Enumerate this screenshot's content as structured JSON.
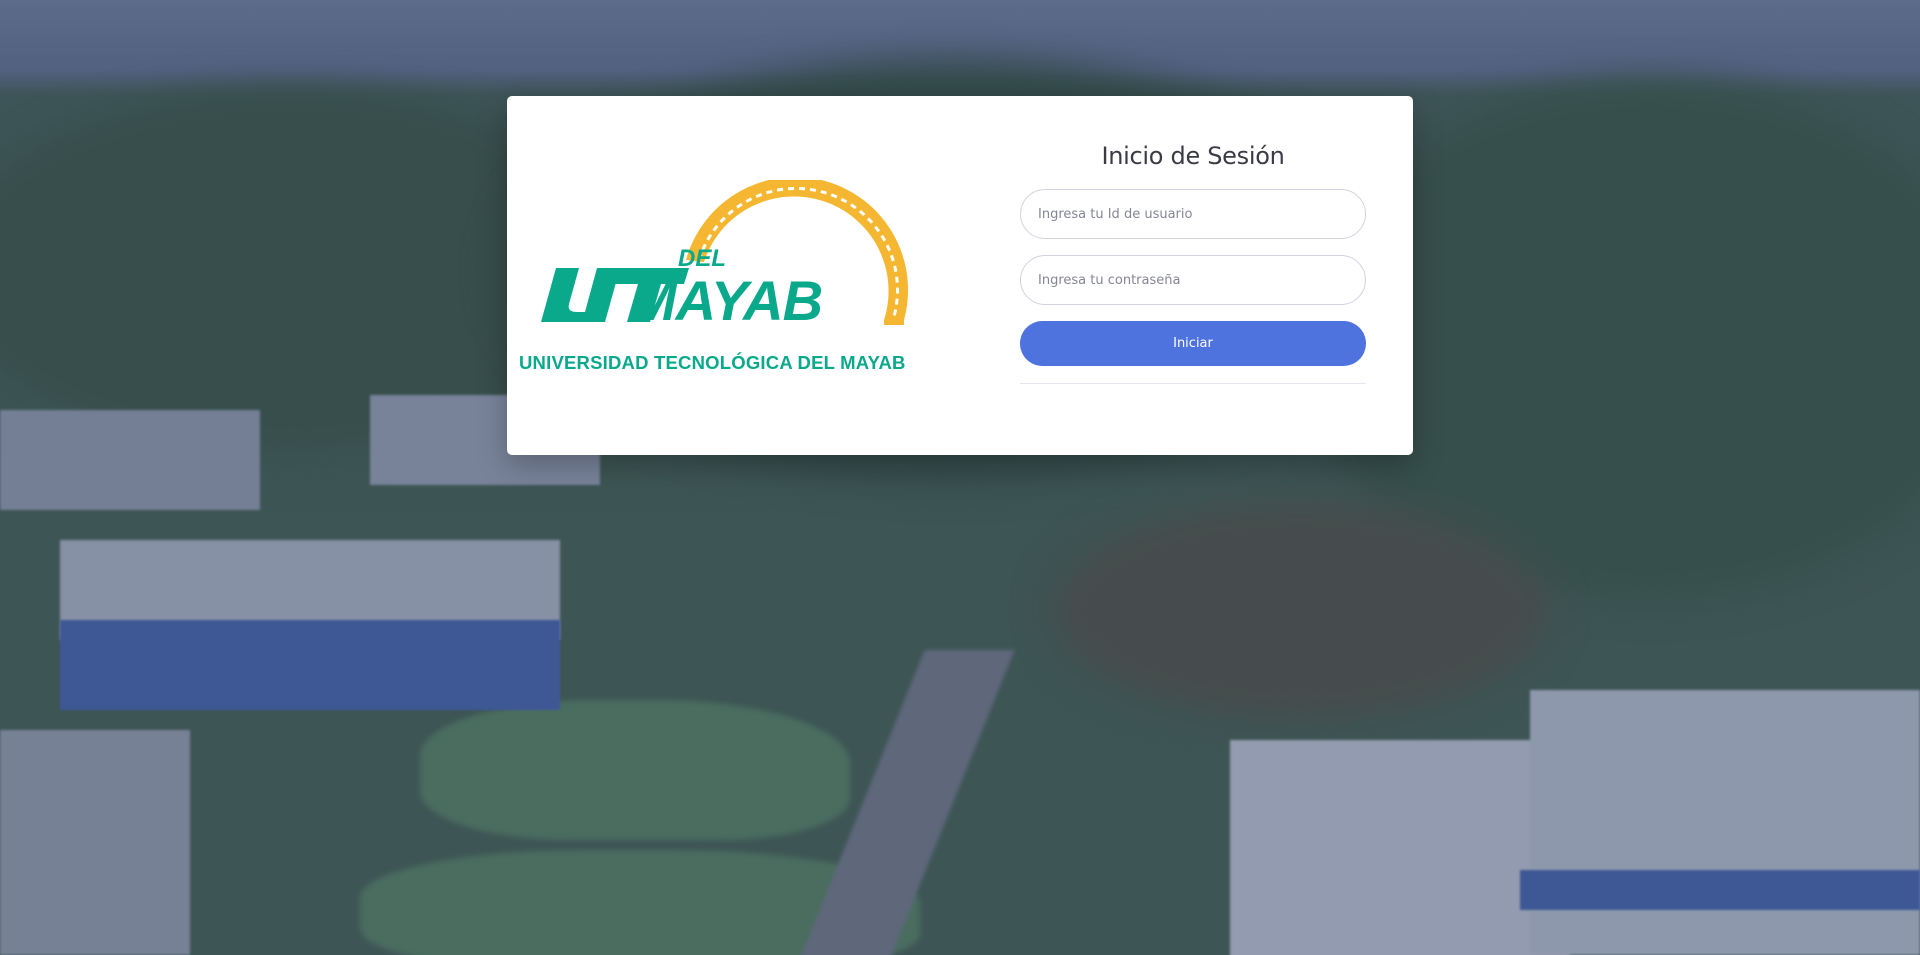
{
  "brand": {
    "logo_del": "DEL",
    "logo_ut": "UT",
    "logo_mayab": "MAYAB",
    "university_name": "UNIVERSIDAD TECNOLÓGICA DEL MAYAB",
    "green": "#0aa98b",
    "gold": "#f5b731"
  },
  "login": {
    "title": "Inicio de Sesión",
    "user_placeholder": "Ingresa tu Id de usuario",
    "password_placeholder": "Ingresa tu contraseña",
    "submit_label": "Iniciar",
    "accent": "#4e73df"
  }
}
